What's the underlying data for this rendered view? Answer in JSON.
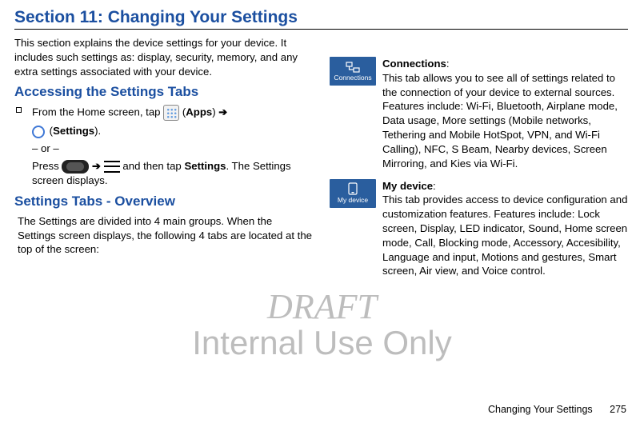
{
  "title": "Section 11: Changing Your Settings",
  "intro": "This section explains the device settings for your device. It includes such settings as: display, security, memory, and any extra settings associated with your device.",
  "accessing": {
    "heading": "Accessing the Settings Tabs",
    "step_a_pre": "From the Home screen, tap ",
    "step_a_apps_label": "Apps",
    "step_a_arrow": " ➔",
    "step_a_settings_label": "Settings",
    "step_a_post": ".",
    "or": "– or –",
    "step_b_pre": "Press ",
    "step_b_arrow": " ➔ ",
    "step_b_mid": " and then tap ",
    "step_b_settings_word": "Settings",
    "step_b_post": ". The Settings screen displays."
  },
  "overview": {
    "heading": "Settings Tabs - Overview",
    "body": "The Settings are divided into 4 main groups. When the Settings screen displays, the following 4 tabs are located at the top of the screen:"
  },
  "tabs": {
    "connections": {
      "icon_label": "Connections",
      "name": "Connections",
      "colon": ":",
      "desc": "This tab allows you to see all of settings related to the connection of your device to external sources. Features include: Wi-Fi, Bluetooth, Airplane mode, Data usage, More settings (Mobile networks, Tethering and Mobile HotSpot, VPN, and Wi-Fi Calling), NFC, S Beam, Nearby devices, Screen Mirroring, and Kies via Wi-Fi."
    },
    "mydevice": {
      "icon_label": "My device",
      "name": "My device",
      "colon": ":",
      "desc": "This tab provides access to device configuration and customization features. Features include: Lock screen, Display, LED indicator, Sound, Home screen mode, Call, Blocking mode, Accessory, Accesibility, Language and input, Motions and gestures, Smart screen, Air view, and Voice control."
    }
  },
  "watermark": {
    "draft": "DRAFT",
    "internal": "Internal Use Only"
  },
  "footer": {
    "text": "Changing Your Settings",
    "page": "275"
  }
}
